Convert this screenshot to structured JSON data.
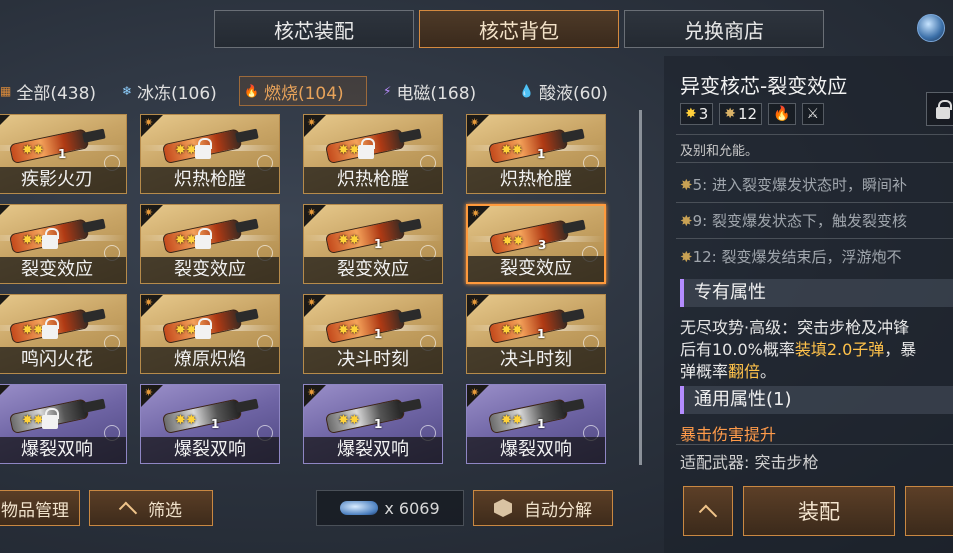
{
  "tabs": [
    {
      "label": "核芯装配",
      "active": false
    },
    {
      "label": "核芯背包",
      "active": true
    },
    {
      "label": "兑换商店",
      "active": false
    }
  ],
  "filters": [
    {
      "icon": "grid-icon",
      "label": "全部(438)",
      "active": false
    },
    {
      "icon": "snowflake-icon",
      "label": "冰冻(106)",
      "active": false
    },
    {
      "icon": "fire-icon",
      "label": "燃烧(104)",
      "active": true
    },
    {
      "icon": "lightning-icon",
      "label": "电磁(168)",
      "active": false
    },
    {
      "icon": "acid-drop-icon",
      "label": "酸液(60)",
      "active": false
    }
  ],
  "cards": [
    {
      "name": "疾影火刃",
      "style": "gold",
      "count": "1",
      "locked": false,
      "selected": false
    },
    {
      "name": "炽热枪膛",
      "style": "gold",
      "count": "",
      "locked": true,
      "selected": false
    },
    {
      "name": "炽热枪膛",
      "style": "gold",
      "count": "",
      "locked": true,
      "selected": false
    },
    {
      "name": "炽热枪膛",
      "style": "gold",
      "count": "1",
      "locked": false,
      "selected": false
    },
    {
      "name": "裂变效应",
      "style": "gold",
      "count": "",
      "locked": true,
      "selected": false
    },
    {
      "name": "裂变效应",
      "style": "gold",
      "count": "",
      "locked": true,
      "selected": false
    },
    {
      "name": "裂变效应",
      "style": "gold",
      "count": "1",
      "locked": false,
      "selected": false
    },
    {
      "name": "裂变效应",
      "style": "gold",
      "count": "3",
      "locked": false,
      "selected": true
    },
    {
      "name": "鸣闪火花",
      "style": "gold",
      "count": "",
      "locked": true,
      "selected": false
    },
    {
      "name": "燎原炽焰",
      "style": "gold",
      "count": "",
      "locked": true,
      "selected": false
    },
    {
      "name": "决斗时刻",
      "style": "gold",
      "count": "1",
      "locked": false,
      "selected": false
    },
    {
      "name": "决斗时刻",
      "style": "gold",
      "count": "1",
      "locked": false,
      "selected": false
    },
    {
      "name": "爆裂双响",
      "style": "purple",
      "count": "",
      "locked": true,
      "selected": false
    },
    {
      "name": "爆裂双响",
      "style": "purple",
      "count": "1",
      "locked": false,
      "selected": false
    },
    {
      "name": "爆裂双响",
      "style": "purple",
      "count": "1",
      "locked": false,
      "selected": false
    },
    {
      "name": "爆裂双响",
      "style": "purple",
      "count": "1",
      "locked": false,
      "selected": false
    }
  ],
  "bottom": {
    "manage_label": "物品管理",
    "filter_label": "筛选",
    "currency_value": "x 6069",
    "auto_decompose_label": "自动分解"
  },
  "detail": {
    "title": "异变核芯-裂变效应",
    "star_level": "3",
    "star_cost": "12",
    "desc_partial": "及别和允能。",
    "tiers": [
      {
        "tier": "5",
        "text": "5: 进入裂变爆发状态时，瞬间补"
      },
      {
        "tier": "9",
        "text": "9: 裂变爆发状态下，触发裂变核"
      },
      {
        "tier": "12",
        "text": "12: 裂变爆发结束后，浮游炮不"
      }
    ],
    "exclusive_title": "专有属性",
    "exclusive_line1": "无尽攻势·高级：突击步枪及冲锋",
    "exclusive_line2a": "后有10.0%概率",
    "exclusive_line2b": "装填2.0子弹",
    "exclusive_line2c": "，暴",
    "exclusive_line3a": "弹概率",
    "exclusive_line3b": "翻倍",
    "exclusive_line3c": "。",
    "general_title": "通用属性(1)",
    "general_attr": "暴击伤害提升",
    "weapon_fit": "适配武器: 突击步枪",
    "equip_label": "装配"
  },
  "colors": {
    "accent": "#c98842",
    "active_filter": "#e8a35a",
    "section_bar": "#b48cff",
    "highlight": "#ffc24a"
  }
}
